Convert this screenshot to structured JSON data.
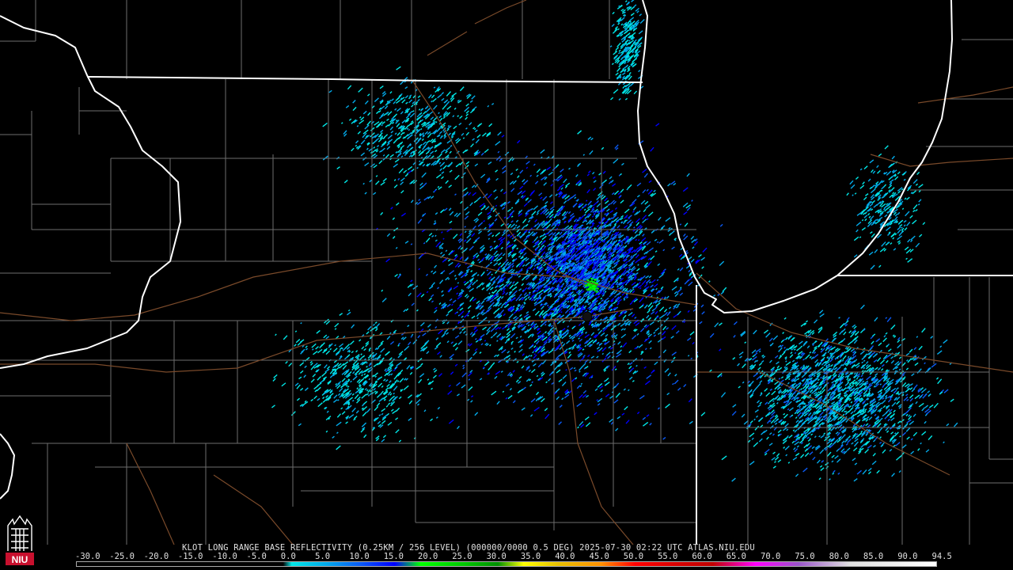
{
  "product": {
    "caption": "KLOT LONG RANGE BASE REFLECTIVITY (0.25KM / 256 LEVEL) (000000/0000 0.5 DEG) 2025-07-30 02:22 UTC  ATLAS.NIU.EDU",
    "radar_site": "KLOT",
    "product_name": "LONG RANGE BASE REFLECTIVITY",
    "resolution": "0.25KM / 256 LEVEL",
    "elevation": "0.5 DEG",
    "timestamp": "2025-07-30 02:22 UTC",
    "source": "ATLAS.NIU.EDU"
  },
  "logo": {
    "text": "NIU",
    "color": "#c8102e"
  },
  "colorbar": {
    "tick_labels": [
      "-30.0",
      "-25.0",
      "-20.0",
      "-15.0",
      "-10.0",
      "-5.0",
      "0.0",
      "5.0",
      "10.0",
      "15.0",
      "20.0",
      "25.0",
      "30.0",
      "35.0",
      "40.0",
      "45.0",
      "50.0",
      "55.0",
      "60.0",
      "65.0",
      "70.0",
      "75.0",
      "80.0",
      "85.0",
      "90.0",
      "94.5"
    ],
    "colors": {
      "below_zero": "#000000",
      "0": "#00e7e7",
      "5": "#02aaea",
      "10": "#0a5af5",
      "15": "#0000ff",
      "20": "#00ff00",
      "25": "#00c800",
      "30": "#009000",
      "35": "#ffff00",
      "40": "#e7c000",
      "45": "#ff9000",
      "50": "#ff0000",
      "55": "#d60000",
      "60": "#c00000",
      "65": "#ff00ff",
      "70": "#9955c9",
      "75": "#e0e0e0",
      "80": "#ffffff"
    }
  },
  "map_style": {
    "background": "#000000",
    "state_border_color": "#ffffff",
    "county_border_color": "#6e6e6e",
    "highway_color": "#7a4a2a",
    "radar_site_marker_color": "#111111"
  },
  "echoes": {
    "dominant_levels": [
      "0.0",
      "5.0",
      "10.0",
      "15.0"
    ],
    "max_level_present": "25.0"
  }
}
